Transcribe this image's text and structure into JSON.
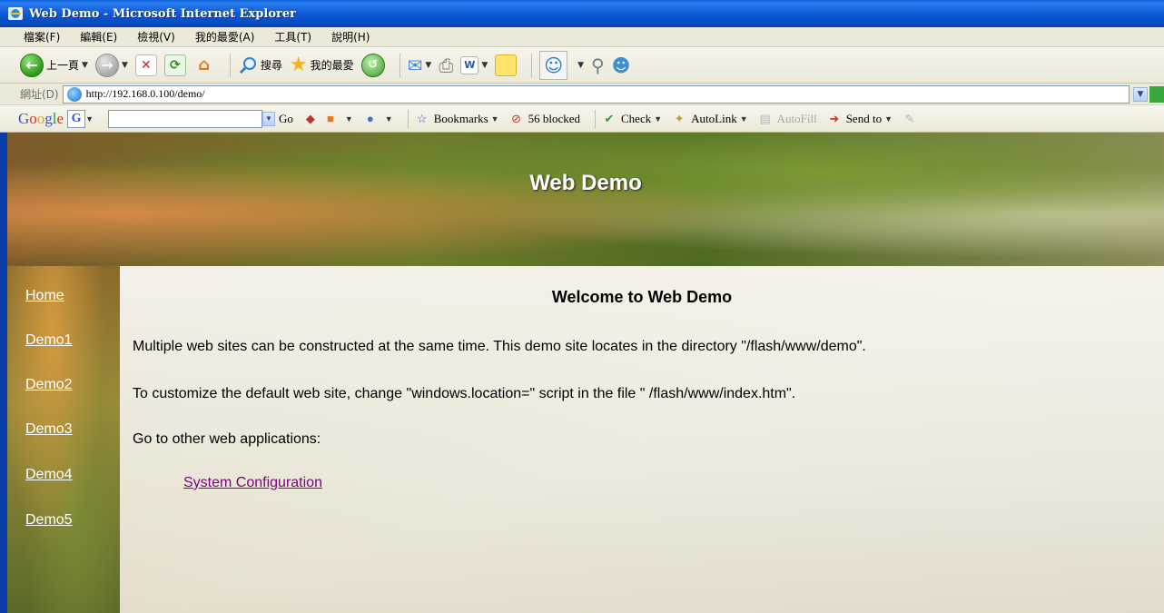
{
  "window": {
    "title": "Web Demo - Microsoft Internet Explorer"
  },
  "menu": {
    "items": [
      "檔案(F)",
      "編輯(E)",
      "檢視(V)",
      "我的最愛(A)",
      "工具(T)",
      "說明(H)"
    ]
  },
  "toolbar": {
    "back_label": "上一頁",
    "search_label": "搜尋",
    "favorites_label": "我的最愛"
  },
  "address": {
    "label": "網址(D)",
    "url": "http://192.168.0.100/demo/"
  },
  "google_toolbar": {
    "logo": "Google",
    "go_label": "Go",
    "bookmarks_label": "Bookmarks",
    "blocked_label": "56 blocked",
    "check_label": "Check",
    "autolink_label": "AutoLink",
    "autofill_label": "AutoFill",
    "sendto_label": "Send to"
  },
  "page": {
    "banner_title": "Web Demo",
    "nav": [
      "Home",
      "Demo1",
      "Demo2",
      "Demo3",
      "Demo4",
      "Demo5"
    ],
    "heading": "Welcome to Web Demo",
    "paragraphs": [
      "Multiple web sites can be constructed at the same time. This demo site locates in the directory \"/flash/www/demo\".",
      "To customize the default web site, change \"windows.location=\" script in the file \" /flash/www/index.htm\".",
      "Go to other web applications:"
    ],
    "link": "System Configuration"
  }
}
